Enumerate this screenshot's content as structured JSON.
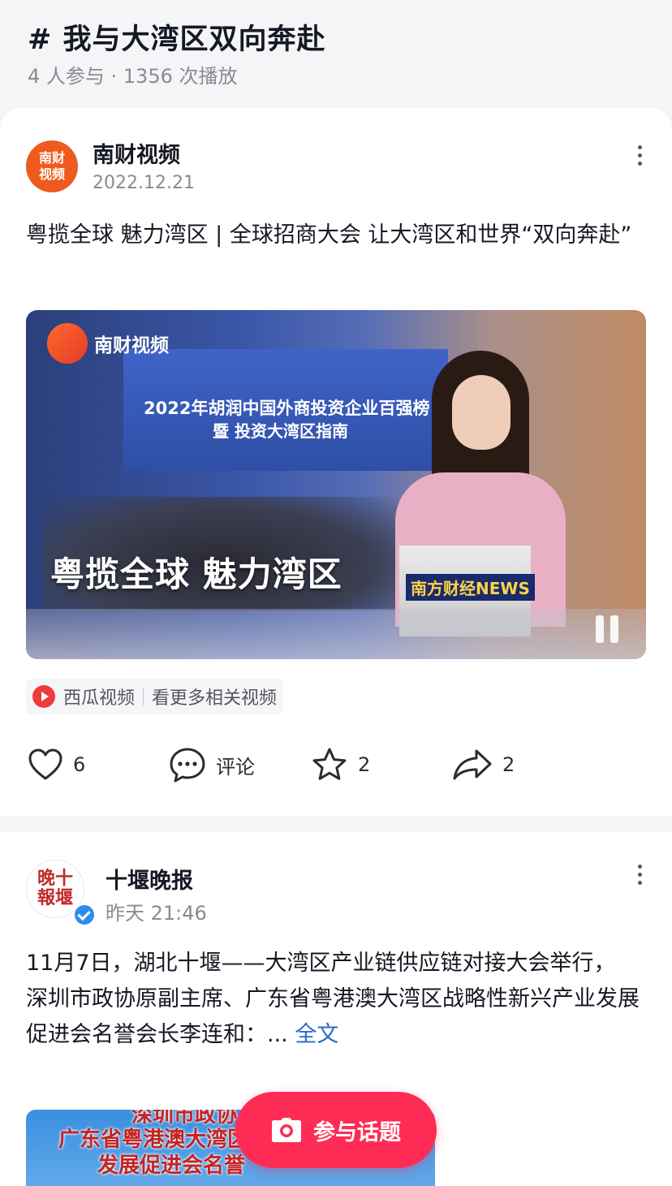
{
  "topic": {
    "title": "# 我与大湾区双向奔赴",
    "stats": "4 人参与 · 1356 次播放"
  },
  "post1": {
    "author": "南财视频",
    "avatar_text": "南财\n视频",
    "date": "2022.12.21",
    "text": "粤揽全球 魅力湾区 | 全球招商大会 让大湾区和世界“双向奔赴”",
    "video": {
      "brand": "南财视频",
      "stage_title_1": "2022年胡润中国外商投资企业百强榜",
      "stage_title_2": "暨 投资大湾区指南",
      "caption": "粤揽全球 魅力湾区",
      "news_badge": "南方财经NEWS"
    },
    "source": {
      "app": "西瓜视频",
      "link": "看更多相关视频"
    },
    "actions": {
      "like_count": "6",
      "comment_label": "评论",
      "favorite_count": "2",
      "share_count": "2"
    }
  },
  "post2": {
    "author": "十堰晚报",
    "avatar_text": "晚十\n報堰",
    "date": "昨天 21:46",
    "text": "11月7日，湖北十堰——大湾区产业链供应链对接大会举行，\n深圳市政协原副主席、广东省粤港澳大湾区战略性新兴产业发展促进会名誉会长李连和：...",
    "read_more": "全文",
    "thumb_lines": [
      "深圳市政协",
      "广东省粤港澳大湾区",
      "发展促进会名誉"
    ]
  },
  "fab": {
    "label": "参与话题"
  },
  "colors": {
    "accent": "#fe2c55",
    "link": "#2b68c9",
    "avatar_nancai": "#ef5a1f",
    "verified": "#2e8cf0"
  },
  "icons": [
    "heart-icon",
    "comment-icon",
    "star-icon",
    "share-icon",
    "more-icon",
    "camera-icon",
    "pause-icon",
    "xigua-icon",
    "verified-icon"
  ]
}
